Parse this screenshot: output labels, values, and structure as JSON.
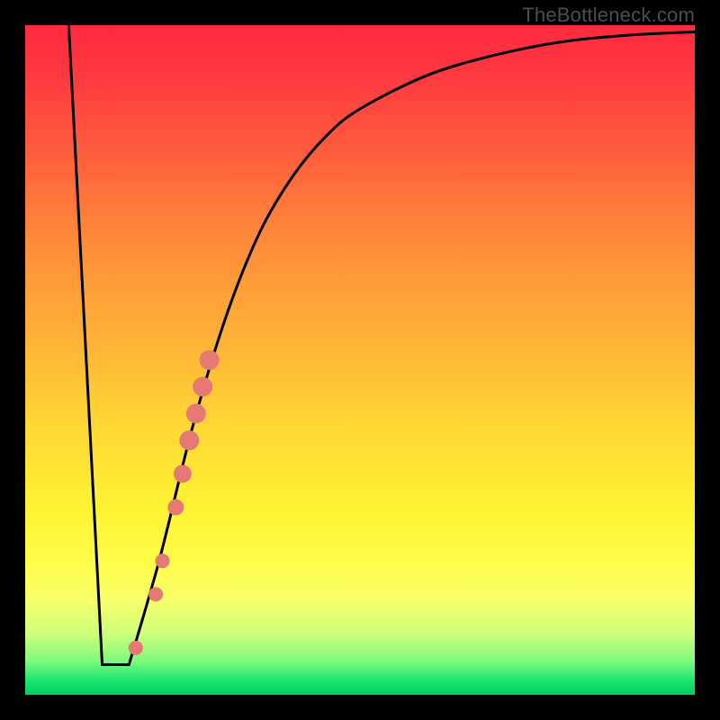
{
  "watermark": "TheBottleneck.com",
  "colors": {
    "frame": "#000000",
    "curve": "#000000",
    "marker": "#e57a74",
    "gradient_top": "#ff2a3f",
    "gradient_bottom": "#00d060"
  },
  "chart_data": {
    "type": "line",
    "title": "",
    "xlabel": "",
    "ylabel": "",
    "xlim": [
      0,
      1
    ],
    "ylim": [
      0,
      1
    ],
    "series": [
      {
        "name": "left-spike",
        "type": "segment",
        "points": [
          {
            "x": 0.065,
            "y": 1.0
          },
          {
            "x": 0.115,
            "y": 0.045
          }
        ]
      },
      {
        "name": "valley-floor",
        "type": "segment",
        "points": [
          {
            "x": 0.115,
            "y": 0.045
          },
          {
            "x": 0.155,
            "y": 0.045
          }
        ]
      },
      {
        "name": "recovery-curve",
        "type": "curve",
        "points": [
          {
            "x": 0.155,
            "y": 0.045
          },
          {
            "x": 0.2,
            "y": 0.2
          },
          {
            "x": 0.25,
            "y": 0.4
          },
          {
            "x": 0.3,
            "y": 0.565
          },
          {
            "x": 0.35,
            "y": 0.69
          },
          {
            "x": 0.4,
            "y": 0.775
          },
          {
            "x": 0.45,
            "y": 0.835
          },
          {
            "x": 0.5,
            "y": 0.875
          },
          {
            "x": 0.6,
            "y": 0.925
          },
          {
            "x": 0.7,
            "y": 0.955
          },
          {
            "x": 0.8,
            "y": 0.975
          },
          {
            "x": 0.9,
            "y": 0.985
          },
          {
            "x": 1.0,
            "y": 0.99
          }
        ]
      }
    ],
    "markers": [
      {
        "x": 0.165,
        "y": 0.07,
        "size": 8
      },
      {
        "x": 0.195,
        "y": 0.15,
        "size": 8
      },
      {
        "x": 0.205,
        "y": 0.2,
        "size": 8
      },
      {
        "x": 0.225,
        "y": 0.28,
        "size": 9
      },
      {
        "x": 0.235,
        "y": 0.33,
        "size": 10
      },
      {
        "x": 0.245,
        "y": 0.38,
        "size": 11
      },
      {
        "x": 0.255,
        "y": 0.42,
        "size": 11
      },
      {
        "x": 0.265,
        "y": 0.46,
        "size": 11
      },
      {
        "x": 0.275,
        "y": 0.5,
        "size": 11
      }
    ]
  }
}
